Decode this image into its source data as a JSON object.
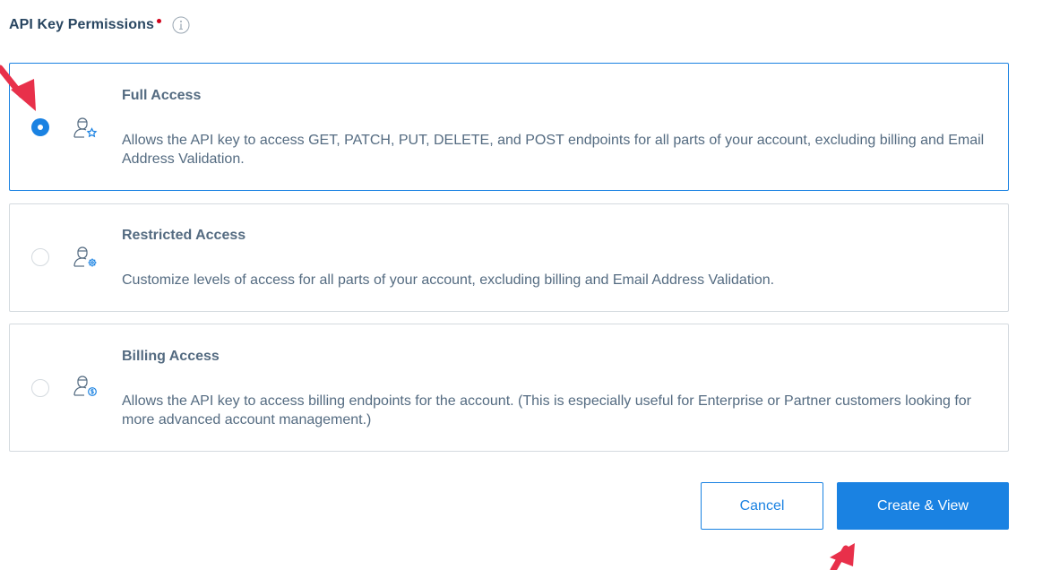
{
  "header": {
    "title": "API Key Permissions"
  },
  "options": [
    {
      "title": "Full Access",
      "description": "Allows the API key to access GET, PATCH, PUT, DELETE, and POST endpoints for all parts of your account, excluding billing and Email Address Validation.",
      "selected": true,
      "icon": "user-star-icon"
    },
    {
      "title": "Restricted Access",
      "description": "Customize levels of access for all parts of your account, excluding billing and Email Address Validation.",
      "selected": false,
      "icon": "user-gear-icon"
    },
    {
      "title": "Billing Access",
      "description": "Allows the API key to access billing endpoints for the account. (This is especially useful for Enterprise or Partner customers looking for more advanced account management.)",
      "selected": false,
      "icon": "user-dollar-icon"
    }
  ],
  "actions": {
    "cancel_label": "Cancel",
    "create_label": "Create & View"
  },
  "colors": {
    "accent": "#1a82e2",
    "required": "#d0021b",
    "annotation_arrow": "#e8304a",
    "text": "#546b81",
    "heading": "#294661"
  }
}
